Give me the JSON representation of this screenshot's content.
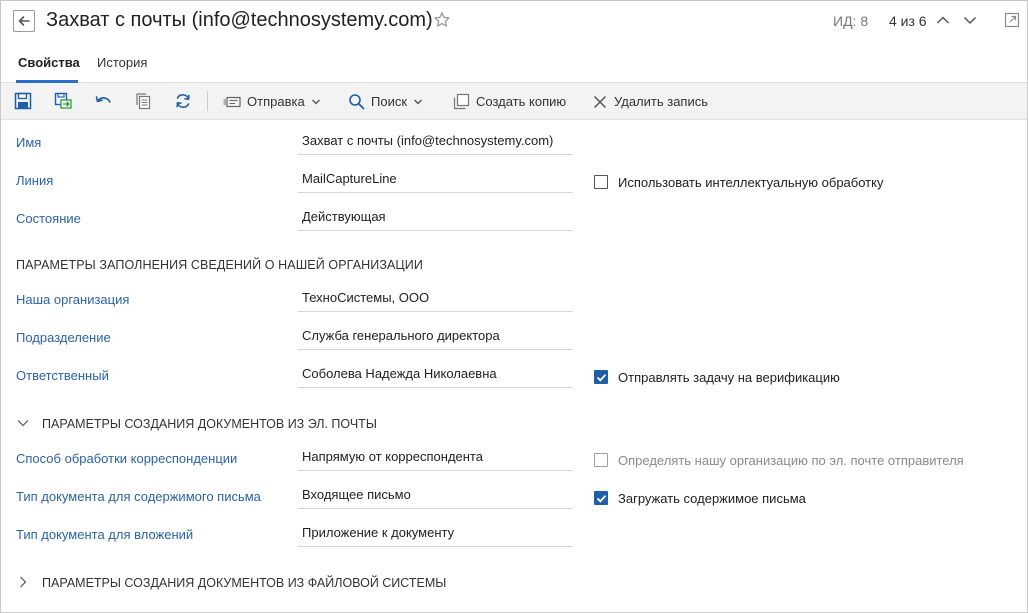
{
  "header": {
    "title": "Захват с почты (info@technosystemy.com)",
    "record_id": "ИД: 8",
    "record_position": "4 из 6"
  },
  "tabs": [
    {
      "label": "Свойства",
      "active": true
    },
    {
      "label": "История",
      "active": false
    }
  ],
  "toolbar": {
    "icons": [
      "save-icon",
      "save-and-close-icon",
      "undo-icon",
      "copy-icon",
      "refresh-icon"
    ],
    "send_label": "Отправка",
    "search_label": "Поиск",
    "create_copy_label": "Создать копию",
    "delete_label": "Удалить запись"
  },
  "fields": {
    "name": {
      "label": "Имя",
      "value": "Захват с почты (info@technosystemy.com)"
    },
    "line": {
      "label": "Линия",
      "value": "MailCaptureLine"
    },
    "state": {
      "label": "Состояние",
      "value": "Действующая"
    }
  },
  "checkboxes": {
    "intelligent": {
      "label": "Использовать интеллектуальную обработку",
      "checked": false,
      "disabled": false
    },
    "verification": {
      "label": "Отправлять задачу на верификацию",
      "checked": true,
      "disabled": false
    },
    "detect_org": {
      "label": "Определять нашу организацию по эл. почте отправителя",
      "checked": false,
      "disabled": true
    },
    "load_content": {
      "label": "Загружать содержимое письма",
      "checked": true,
      "disabled": false
    }
  },
  "section_org": {
    "title": "ПАРАМЕТРЫ ЗАПОЛНЕНИЯ СВЕДЕНИЙ О НАШЕЙ ОРГАНИЗАЦИИ",
    "our_org": {
      "label": "Наша организация",
      "value": "ТехноСистемы, ООО"
    },
    "department": {
      "label": "Подразделение",
      "value": "Служба генерального директора"
    },
    "responsible": {
      "label": "Ответственный",
      "value": "Соболева Надежда Николаевна"
    }
  },
  "section_email": {
    "title": "ПАРАМЕТРЫ СОЗДАНИЯ ДОКУМЕНТОВ ИЗ ЭЛ. ПОЧТЫ",
    "expanded": true,
    "processing_method": {
      "label": "Способ обработки корреспонденции",
      "value": "Напрямую от корреспондента"
    },
    "content_doc_type": {
      "label": "Тип документа для содержимого письма",
      "value": "Входящее письмо"
    },
    "attachments_doc_type": {
      "label": "Тип документа для вложений",
      "value": "Приложение к документу"
    }
  },
  "section_files": {
    "title": "ПАРАМЕТРЫ СОЗДАНИЯ ДОКУМЕНТОВ ИЗ ФАЙЛОВОЙ СИСТЕМЫ",
    "expanded": false
  },
  "colors": {
    "label_blue": "#2b63a8",
    "checkbox_checked": "#1f5fa8",
    "tab_underline": "#2a6fc9",
    "toolbar_icon_blue": "#1d5fa8"
  }
}
